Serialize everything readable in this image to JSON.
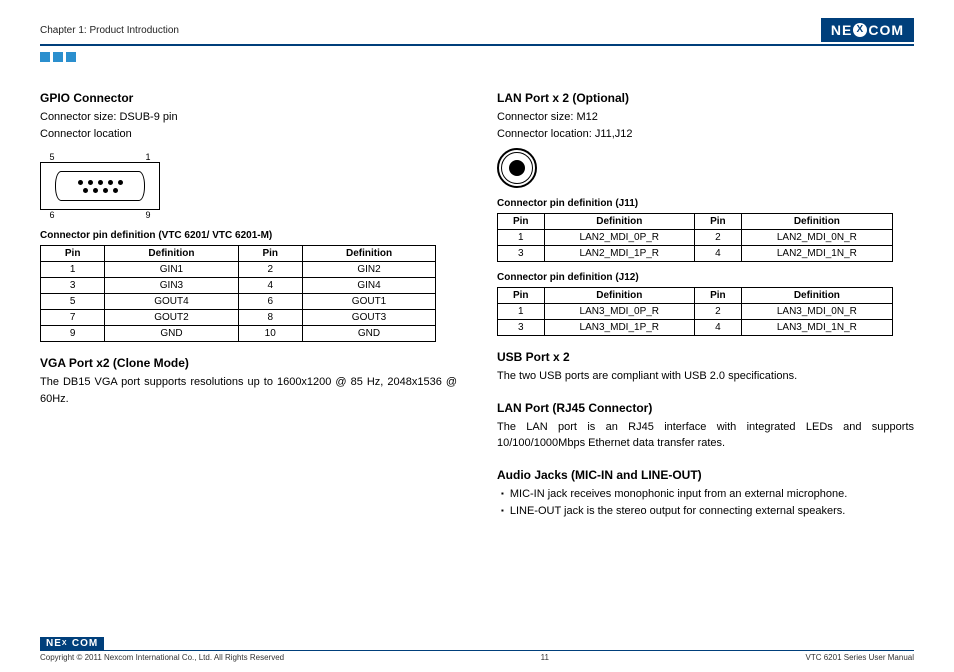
{
  "header": {
    "chapter": "Chapter 1: Product Introduction",
    "logo_pre": "NE",
    "logo_x": "X",
    "logo_post": "COM"
  },
  "left": {
    "gpio": {
      "title": "GPIO Connector",
      "size": "Connector size: DSUB-9 pin",
      "loc": "Connector location",
      "diag_top_left": "5",
      "diag_top_right": "1",
      "diag_bot_left": "6",
      "diag_bot_right": "9",
      "table_caption": "Connector pin definition (VTC 6201/ VTC 6201-M)",
      "table_headers": [
        "Pin",
        "Definition",
        "Pin",
        "Definition"
      ],
      "table_rows": [
        [
          "1",
          "GIN1",
          "2",
          "GIN2"
        ],
        [
          "3",
          "GIN3",
          "4",
          "GIN4"
        ],
        [
          "5",
          "GOUT4",
          "6",
          "GOUT1"
        ],
        [
          "7",
          "GOUT2",
          "8",
          "GOUT3"
        ],
        [
          "9",
          "GND",
          "10",
          "GND"
        ]
      ]
    },
    "vga": {
      "title": "VGA Port x2 (Clone Mode)",
      "text": "The DB15 VGA port supports resolutions up to 1600x1200 @ 85 Hz, 2048x1536 @ 60Hz."
    }
  },
  "right": {
    "lan": {
      "title": "LAN Port x 2 (Optional)",
      "size": "Connector size: M12",
      "loc": "Connector location: J11,J12",
      "j11_caption": "Connector pin definition (J11)",
      "j11_headers": [
        "Pin",
        "Definition",
        "Pin",
        "Definition"
      ],
      "j11_rows": [
        [
          "1",
          "LAN2_MDI_0P_R",
          "2",
          "LAN2_MDI_0N_R"
        ],
        [
          "3",
          "LAN2_MDI_1P_R",
          "4",
          "LAN2_MDI_1N_R"
        ]
      ],
      "j12_caption": "Connector pin definition (J12)",
      "j12_headers": [
        "Pin",
        "Definition",
        "Pin",
        "Definition"
      ],
      "j12_rows": [
        [
          "1",
          "LAN3_MDI_0P_R",
          "2",
          "LAN3_MDI_0N_R"
        ],
        [
          "3",
          "LAN3_MDI_1P_R",
          "4",
          "LAN3_MDI_1N_R"
        ]
      ]
    },
    "usb": {
      "title": "USB Port x 2",
      "text": "The two USB ports are compliant with USB 2.0 specifications."
    },
    "rj45": {
      "title": "LAN Port (RJ45 Connector)",
      "text": "The LAN port is an RJ45 interface with integrated LEDs and supports 10/100/1000Mbps Ethernet data transfer rates."
    },
    "audio": {
      "title": "Audio Jacks (MIC-IN and LINE-OUT)",
      "bullets": [
        "MIC-IN jack receives monophonic input from an external microphone.",
        "LINE-OUT jack is the stereo output for connecting external speakers."
      ]
    }
  },
  "footer": {
    "copyright": "Copyright © 2011 Nexcom International Co., Ltd. All Rights Reserved",
    "page": "11",
    "manual": "VTC 6201 Series User Manual"
  }
}
